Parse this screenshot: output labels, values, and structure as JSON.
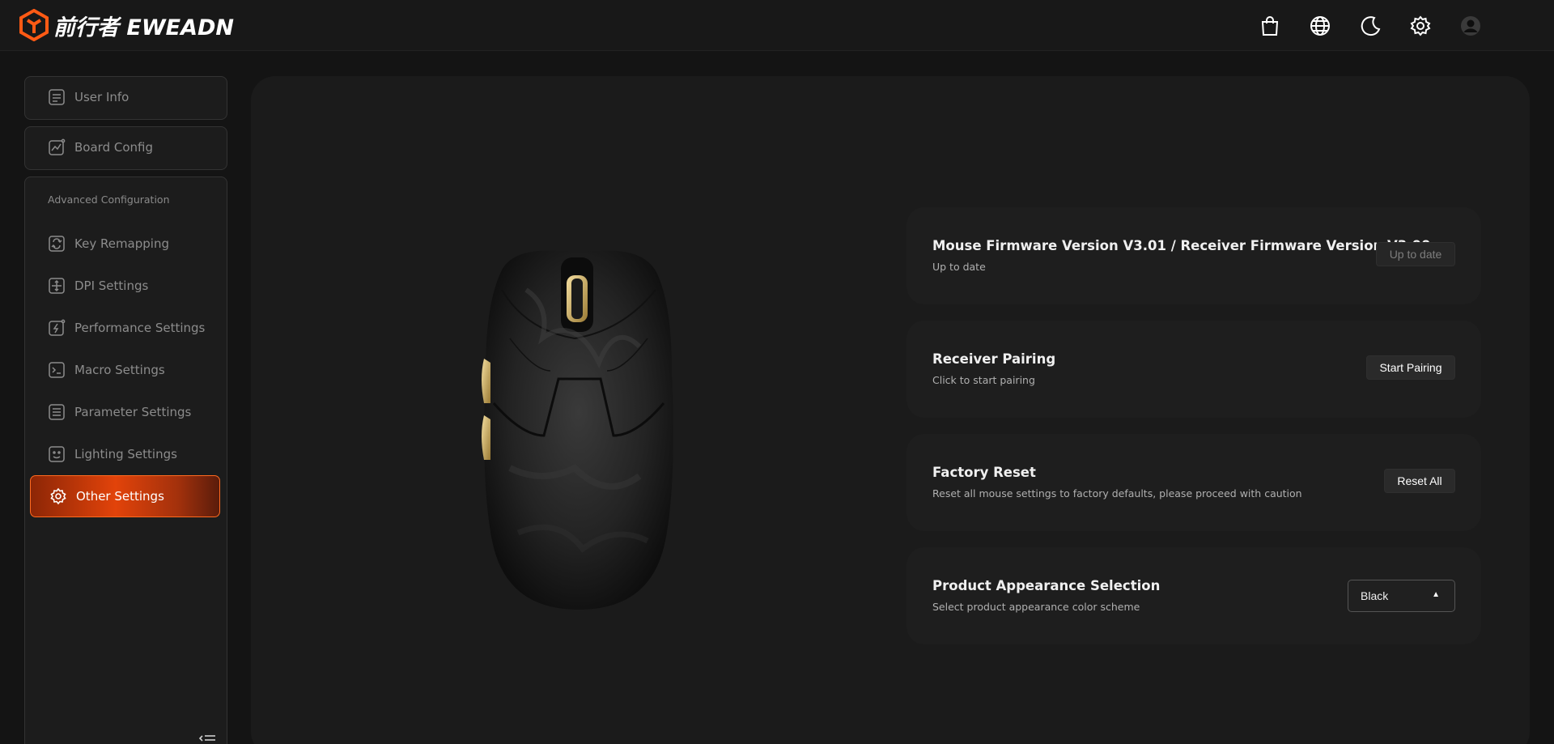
{
  "header": {
    "brand": "前行者 EWEADN",
    "icons": [
      "shop-bag-icon",
      "globe-icon",
      "moon-icon",
      "gear-icon",
      "user-avatar-icon"
    ]
  },
  "sidebar": {
    "top_items": [
      {
        "label": "User Info",
        "icon": "profile-card-icon"
      },
      {
        "label": "Board Config",
        "icon": "chart-board-icon"
      }
    ],
    "section_label": "Advanced Configuration",
    "items": [
      {
        "label": "Key Remapping",
        "icon": "remap-icon"
      },
      {
        "label": "DPI Settings",
        "icon": "dpi-icon"
      },
      {
        "label": "Performance Settings",
        "icon": "performance-icon"
      },
      {
        "label": "Macro Settings",
        "icon": "terminal-icon"
      },
      {
        "label": "Parameter Settings",
        "icon": "list-icon"
      },
      {
        "label": "Lighting Settings",
        "icon": "lighting-icon"
      },
      {
        "label": "Other Settings",
        "icon": "gear-icon",
        "active": true
      }
    ]
  },
  "cards": [
    {
      "title": "Mouse Firmware Version V3.01 / Receiver Firmware Version V3.00",
      "subtitle": "Up to date",
      "button": "Up to date"
    },
    {
      "title": "Receiver Pairing",
      "subtitle": "Click to start pairing",
      "button": "Start Pairing"
    },
    {
      "title": "Factory Reset",
      "subtitle": "Reset all mouse settings to factory defaults, please proceed with caution",
      "button": "Reset All"
    },
    {
      "title": "Product Appearance Selection",
      "subtitle": "Select product appearance color scheme",
      "select_value": "Black",
      "select_arrow": "▲"
    }
  ],
  "colors": {
    "accent": "#ff5a14",
    "background": "#141414",
    "panel": "#1b1b1b"
  }
}
